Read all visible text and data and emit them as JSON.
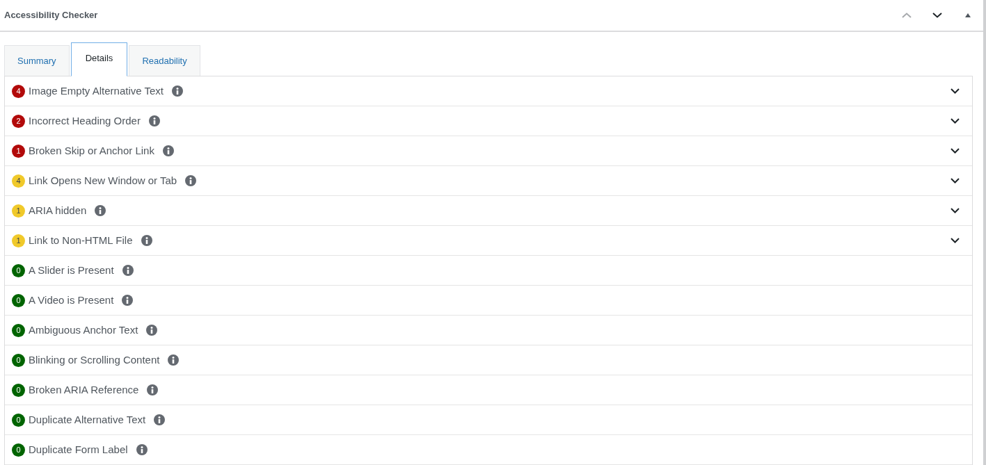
{
  "panel": {
    "title": "Accessibility Checker",
    "expanded": true,
    "controls": [
      {
        "kind": "move-up",
        "disabled": true
      },
      {
        "kind": "move-down",
        "disabled": false
      },
      {
        "kind": "toggle",
        "disabled": false
      }
    ]
  },
  "tabs": [
    {
      "label": "Summary",
      "selected": false
    },
    {
      "label": "Details",
      "selected": true
    },
    {
      "label": "Readability",
      "selected": false
    }
  ],
  "issues": [
    {
      "count": "4",
      "title": "Image Empty Alternative Text",
      "color": "#b20a0a",
      "expandable": true
    },
    {
      "count": "2",
      "title": "Incorrect Heading Order",
      "color": "#b20a0a",
      "expandable": true
    },
    {
      "count": "1",
      "title": "Broken Skip or Anchor Link",
      "color": "#b20a0a",
      "expandable": true
    },
    {
      "count": "4",
      "title": "Link Opens New Window or Tab",
      "color": "#f0c92a",
      "expandable": true
    },
    {
      "count": "1",
      "title": "ARIA hidden",
      "color": "#f0c92a",
      "expandable": true
    },
    {
      "count": "1",
      "title": "Link to Non-HTML File",
      "color": "#f0c92a",
      "expandable": true
    },
    {
      "count": "0",
      "title": "A Slider is Present",
      "color": "#006400",
      "expandable": false
    },
    {
      "count": "0",
      "title": "A Video is Present",
      "color": "#006400",
      "expandable": false
    },
    {
      "count": "0",
      "title": "Ambiguous Anchor Text",
      "color": "#006400",
      "expandable": false
    },
    {
      "count": "0",
      "title": "Blinking or Scrolling Content",
      "color": "#006400",
      "expandable": false
    },
    {
      "count": "0",
      "title": "Broken ARIA Reference",
      "color": "#006400",
      "expandable": false
    },
    {
      "count": "0",
      "title": "Duplicate Alternative Text",
      "color": "#006400",
      "expandable": false
    },
    {
      "count": "0",
      "title": "Duplicate Form Label",
      "color": "#006400",
      "expandable": false
    }
  ]
}
